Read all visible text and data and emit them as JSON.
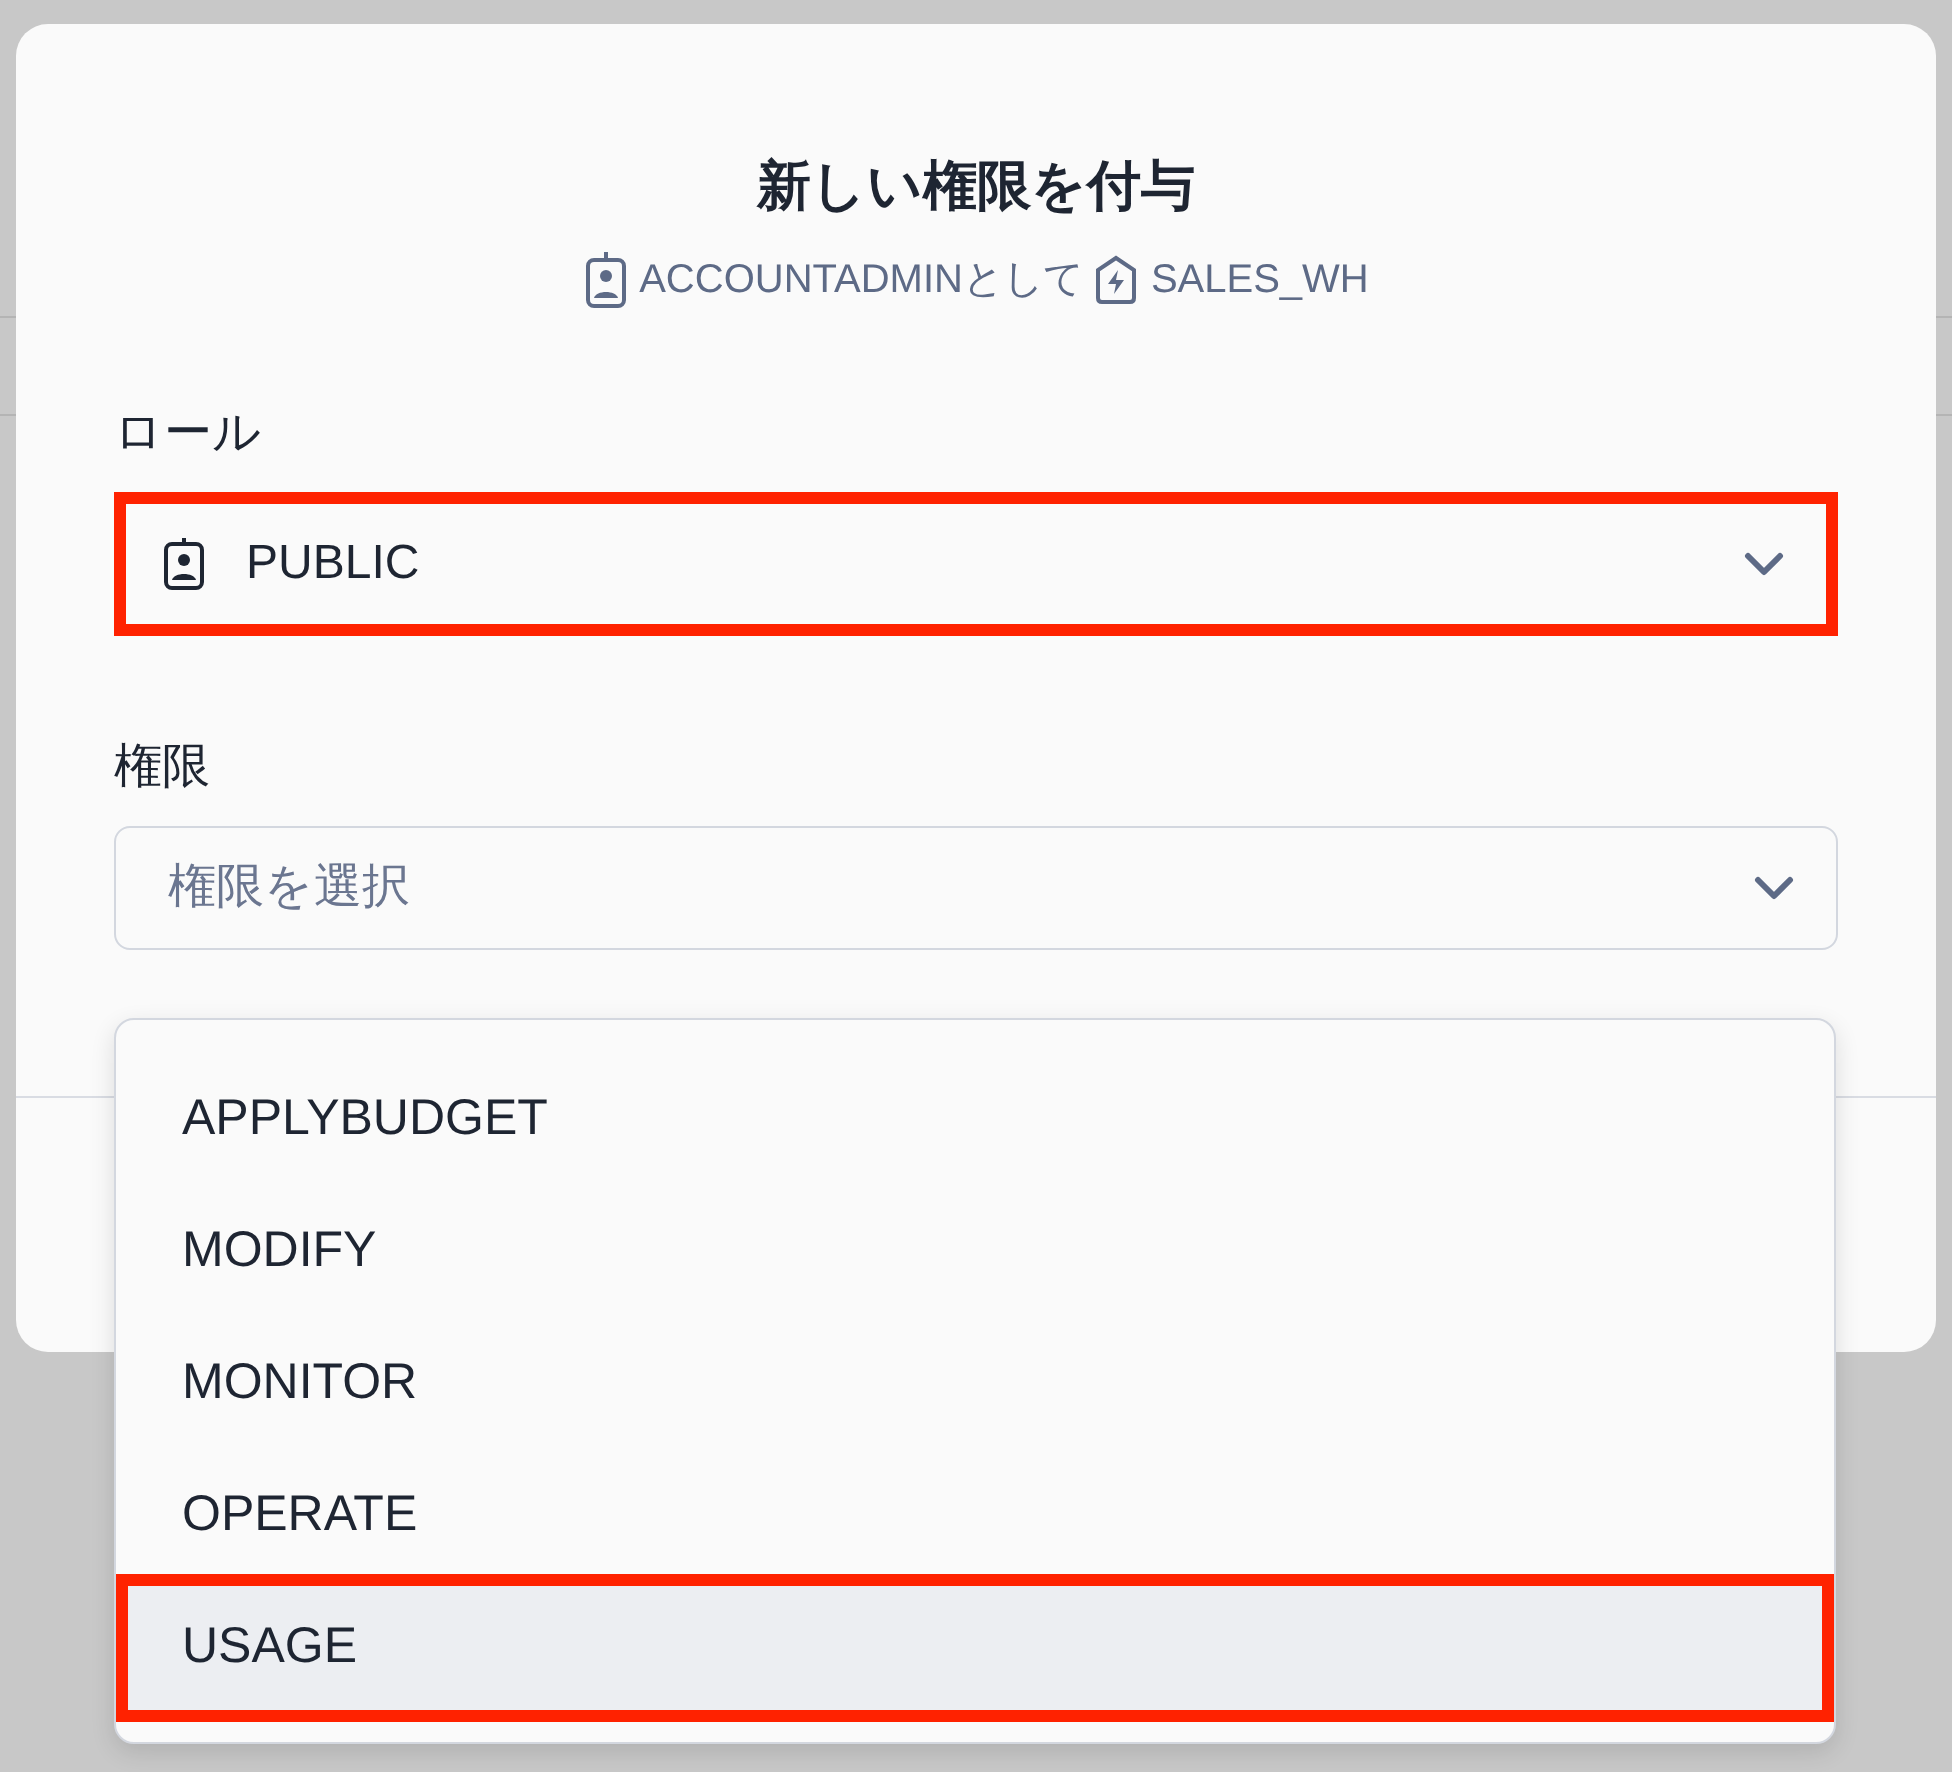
{
  "dialog": {
    "title": "新しい権限を付与",
    "context": {
      "role": "ACCOUNTADMINとして",
      "warehouse": "SALES_WH"
    }
  },
  "role_field": {
    "label": "ロール",
    "value": "PUBLIC",
    "highlighted": true
  },
  "privilege_field": {
    "label": "権限",
    "placeholder": "権限を選択",
    "expanded": true
  },
  "options": [
    {
      "label": "APPLYBUDGET",
      "selected": false,
      "highlighted": false
    },
    {
      "label": "MODIFY",
      "selected": false,
      "highlighted": false
    },
    {
      "label": "MONITOR",
      "selected": false,
      "highlighted": false
    },
    {
      "label": "OPERATE",
      "selected": false,
      "highlighted": false
    },
    {
      "label": "USAGE",
      "selected": true,
      "highlighted": true
    }
  ]
}
